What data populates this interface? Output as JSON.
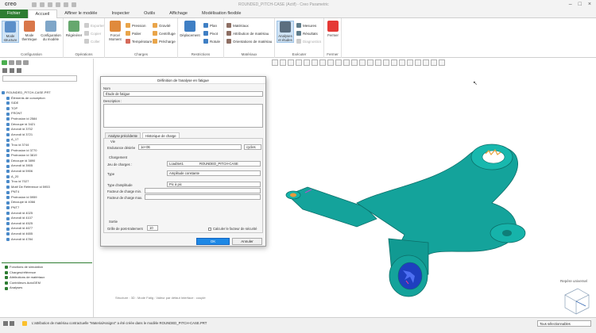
{
  "app": {
    "logo": "creo",
    "window_title": "ROUNDED_PITCH-CASE (Actif) - Creo Parametric"
  },
  "tabs": [
    "Fichier",
    "Accueil",
    "Affiner le modèle",
    "Inspecter",
    "Outils",
    "Affichage",
    "Modélisation flexible"
  ],
  "ribbon": {
    "config": {
      "label": "Configuration",
      "buttons": [
        "Mode structure",
        "Mode thermique",
        "Configuration du modèle"
      ]
    },
    "operations": {
      "label": "Opérations",
      "regen": "Régénérer",
      "small": [
        "Exporter",
        "Copier",
        "Coller"
      ]
    },
    "charges": {
      "label": "Charges",
      "big": "Force/ Moment",
      "small": [
        "Pression",
        "Palier",
        "Température",
        "Gravité",
        "Centrifuge",
        "Précharge"
      ]
    },
    "restrictions": {
      "label": "Restrictions",
      "big": "Déplacement",
      "small": [
        "Plan",
        "Pivot",
        "Rotule"
      ]
    },
    "materiaux": {
      "label": "Matériaux",
      "small": [
        "Matériaux",
        "Attribution de matériau",
        "Orientations de matériau"
      ]
    },
    "executer": {
      "label": "Exécuter",
      "big": "Analyses et études",
      "small": [
        "Mesures",
        "Résultats",
        "Diagnostics"
      ]
    },
    "fermer": {
      "label": "Fermer",
      "big": "Fermer"
    }
  },
  "left_panel": {
    "search_placeholder": "",
    "tree": [
      "ROUNDED_PITCH-CASE.PRT",
      "Éléments de conception",
      "SIDE",
      "TOP",
      "FRONT",
      "Protrusion id 2584",
      "Découpe id 3421",
      "Arrondi id 3702",
      "Arrondi id 3721",
      "A_17",
      "Trou id 3744",
      "Protrusion id 3770",
      "Protrusion id 3819",
      "Découpe id 3890",
      "Arrondi id 3905",
      "Arrondi id 5906",
      "A_20",
      "Trou id 7027",
      "Motif De Référence id 5953",
      "PNT4",
      "Protrusion id 5959",
      "Découpe id 4066",
      "PNT7",
      "Arrondi id 4025",
      "Arrondi id 4107",
      "Arrondi id 4525",
      "Arrondi id 4677",
      "Arrondi id 4655",
      "Arrondi id 4784"
    ],
    "sim_tree": [
      "Fonctions de simulation",
      "Charges/référence",
      "Attributions de matériaux",
      "Contrôleurs AutoGEM",
      "Analyses"
    ]
  },
  "dialog": {
    "title": "Définition de l'analyse en fatigue",
    "name_label": "Nom",
    "name_value": "Étude de fatigue",
    "desc_label": "Description :",
    "tabs": [
      "Analyse précédente",
      "Historique de charge"
    ],
    "vie_label": "Vie",
    "endurance_label": "Endurance désirée",
    "endurance_value": "1e+06",
    "endurance_unit": "cycles",
    "chargement_label": "Chargement",
    "jeu_label": "Jeu de charges :",
    "jeu_value1": "LoadSet1",
    "jeu_value2": "ROUNDED_PITCH-CASE",
    "type_label": "Type",
    "type_value": "Amplitude constante",
    "type_ampl_label": "Type d'amplitude",
    "type_ampl_value": "Pic à pic",
    "fmin_label": "Facteur de charge min.",
    "fmax_label": "Facteur de charge max.",
    "sortie_label": "Sortie",
    "grille_label": "Grille de post-traitement",
    "grille_value": "10",
    "securite_label": "Calculer le facteur de sécurité",
    "ok": "OK",
    "cancel": "Annuler"
  },
  "viewport": {
    "status": "Structure : 3D : Mode Fatig : Valeur par défaut Interface : couplé",
    "csys_label": "Repère universel"
  },
  "status_bar": {
    "message": "L'attribution de matériau contractuelle \"MaterialAssign4\" a été créée dans le modèle ROUNDED_PITCH-CASE.PRT",
    "filter": "Tous sélectionnables"
  },
  "colors": {
    "accent": "#2e7d32",
    "part": "#14a39b",
    "button": "#1e88e5"
  }
}
